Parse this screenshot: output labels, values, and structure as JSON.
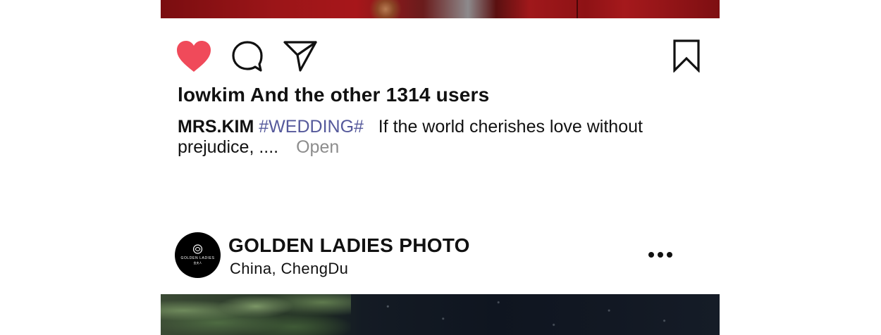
{
  "previous_post": {
    "image_label": "previous post photo"
  },
  "actions": {
    "like_icon": "heart-icon",
    "like_color": "#f04a5a",
    "comment_icon": "comment-icon",
    "share_icon": "send-icon",
    "save_icon": "bookmark-icon",
    "liked": true
  },
  "likes": {
    "text": "lowkim And the other 1314 users"
  },
  "caption": {
    "author": "MRS.KIM",
    "hashtag": "#WEDDING#",
    "text": "If the world cherishes love without prejudice, ....",
    "open_label": "Open",
    "hashtag_color": "#55599b"
  },
  "next_post": {
    "account_name": "GOLDEN LADIES PHOTO",
    "location": "China,  ChengDu",
    "avatar_text": "GOLDEN LADIES",
    "avatar_subtext": "金夫人",
    "more_icon": "more-horizontal-icon"
  }
}
